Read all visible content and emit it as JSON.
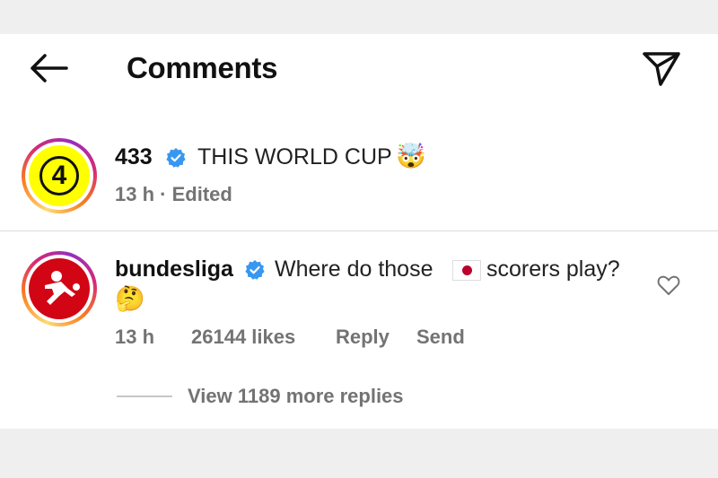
{
  "header": {
    "title": "Comments",
    "back_icon": "arrow-left-icon",
    "send_icon": "paper-plane-icon"
  },
  "comments": [
    {
      "username": "433",
      "verified": true,
      "text": "THIS WORLD CUP",
      "emoji": "🤯",
      "time": "13 h",
      "edited": "Edited",
      "avatar_icon": "433-logo-icon"
    },
    {
      "username": "bundesliga",
      "verified": true,
      "text_before": "Where do those",
      "flag": "japan-flag-icon",
      "text_after": "scorers play?",
      "emoji": "🤔",
      "time": "13 h",
      "likes": "26144 likes",
      "reply_label": "Reply",
      "send_label": "Send",
      "avatar_icon": "bundesliga-logo-icon"
    }
  ],
  "replies": {
    "label": "View 1189 more replies"
  },
  "colors": {
    "verified": "#3897f0",
    "meta": "#737373",
    "bundesliga_red": "#d20515",
    "yellow_433": "#ffff00"
  }
}
